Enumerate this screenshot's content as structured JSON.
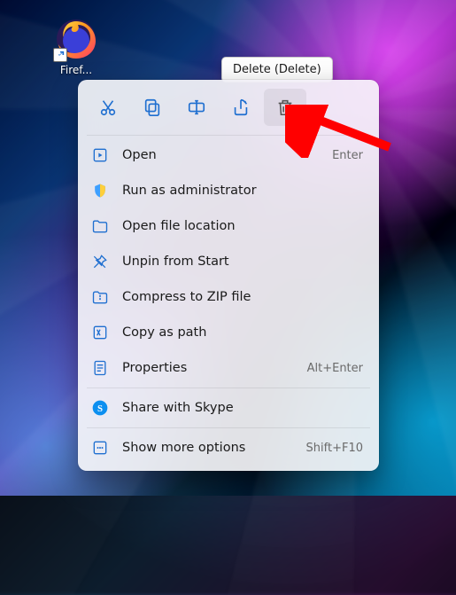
{
  "desktop": {
    "icon_label": "Firef..."
  },
  "tooltip": {
    "text": "Delete (Delete)"
  },
  "action_icons": {
    "cut": "cut-icon",
    "copy": "copy-icon",
    "rename": "rename-icon",
    "share": "share-icon",
    "delete": "delete-icon"
  },
  "menu": {
    "open": {
      "label": "Open",
      "accel": "Enter"
    },
    "run_admin": {
      "label": "Run as administrator",
      "accel": ""
    },
    "open_location": {
      "label": "Open file location",
      "accel": ""
    },
    "unpin": {
      "label": "Unpin from Start",
      "accel": ""
    },
    "compress": {
      "label": "Compress to ZIP file",
      "accel": ""
    },
    "copy_path": {
      "label": "Copy as path",
      "accel": ""
    },
    "properties": {
      "label": "Properties",
      "accel": "Alt+Enter"
    },
    "share_skype": {
      "label": "Share with Skype",
      "accel": ""
    },
    "more_options": {
      "label": "Show more options",
      "accel": "Shift+F10"
    }
  },
  "colors": {
    "accent_blue": "#1f6fd0",
    "arrow_red": "#ff0000"
  }
}
